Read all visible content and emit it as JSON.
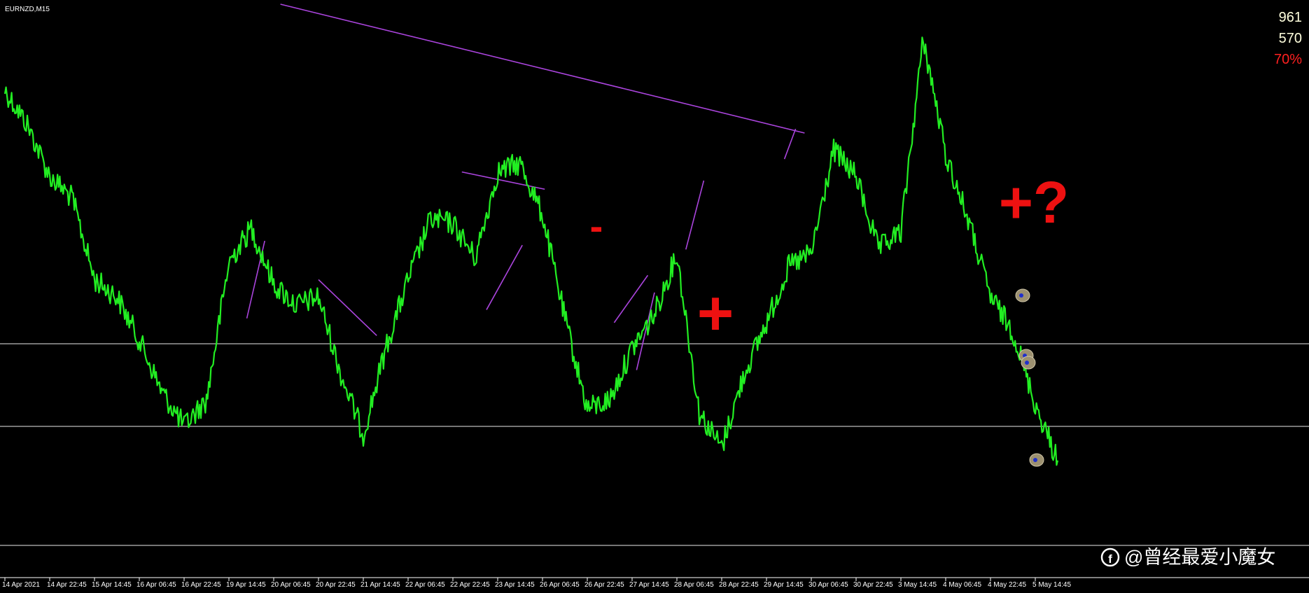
{
  "chart_data": {
    "type": "line",
    "title": "EURNZD,M15",
    "stats": [
      {
        "text": "961",
        "color": "#FFFFDD"
      },
      {
        "text": "570",
        "color": "#FFFFDD"
      },
      {
        "text": "70%",
        "color": "#FF2020"
      }
    ],
    "x_ticks": [
      "14 Apr 2021",
      "14 Apr 22:45",
      "15 Apr 14:45",
      "16 Apr 06:45",
      "16 Apr 22:45",
      "19 Apr 14:45",
      "20 Apr 06:45",
      "20 Apr 22:45",
      "21 Apr 14:45",
      "22 Apr 06:45",
      "22 Apr 22:45",
      "23 Apr 14:45",
      "26 Apr 06:45",
      "26 Apr 22:45",
      "27 Apr 14:45",
      "28 Apr 06:45",
      "28 Apr 22:45",
      "29 Apr 14:45",
      "30 Apr 06:45",
      "30 Apr 22:45",
      "3 May 14:45",
      "4 May 06:45",
      "4 May 22:45",
      "5 May 14:45"
    ],
    "price_path": [
      [
        0,
        0.88
      ],
      [
        0.5,
        0.8
      ],
      [
        1,
        0.68
      ],
      [
        1.5,
        0.63
      ],
      [
        2,
        0.44
      ],
      [
        2.5,
        0.4
      ],
      [
        3,
        0.3
      ],
      [
        3.5,
        0.18
      ],
      [
        4,
        0.1
      ],
      [
        4.5,
        0.16
      ],
      [
        5,
        0.48
      ],
      [
        5.5,
        0.56
      ],
      [
        6,
        0.43
      ],
      [
        6.5,
        0.38
      ],
      [
        7,
        0.4
      ],
      [
        7.5,
        0.22
      ],
      [
        8,
        0.08
      ],
      [
        8.5,
        0.28
      ],
      [
        9,
        0.44
      ],
      [
        9.5,
        0.58
      ],
      [
        10,
        0.57
      ],
      [
        10.5,
        0.49
      ],
      [
        11,
        0.69
      ],
      [
        11.5,
        0.71
      ],
      [
        12,
        0.59
      ],
      [
        12.5,
        0.35
      ],
      [
        13,
        0.14
      ],
      [
        13.5,
        0.16
      ],
      [
        14,
        0.28
      ],
      [
        14.5,
        0.36
      ],
      [
        15,
        0.5
      ],
      [
        15.5,
        0.13
      ],
      [
        16,
        0.05
      ],
      [
        16.5,
        0.22
      ],
      [
        17,
        0.34
      ],
      [
        17.5,
        0.47
      ],
      [
        18,
        0.5
      ],
      [
        18.5,
        0.74
      ],
      [
        19,
        0.68
      ],
      [
        19.5,
        0.51
      ],
      [
        20,
        0.55
      ],
      [
        20.5,
        1.0
      ],
      [
        21,
        0.73
      ],
      [
        21.5,
        0.58
      ],
      [
        22,
        0.4
      ],
      [
        22.5,
        0.32
      ],
      [
        23,
        0.15
      ],
      [
        23.5,
        0.02
      ]
    ],
    "annotations": [
      {
        "text": "-",
        "color": "#EE1111"
      },
      {
        "text": "+",
        "color": "#EE1111"
      },
      {
        "text": "+?",
        "color": "#EE1111"
      }
    ],
    "series_color": "#22EE22",
    "trendline_color": "#AA44DD",
    "level_color": "#BBBBBB"
  },
  "watermark": "@曾经最爱小魔女"
}
